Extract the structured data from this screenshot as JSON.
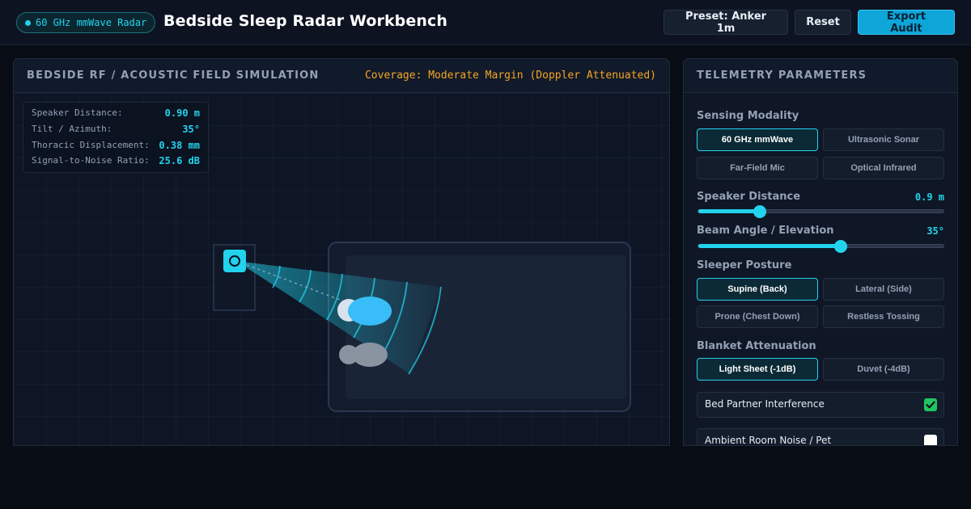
{
  "header": {
    "badge": "60 GHz mmWave Radar",
    "title": "Bedside Sleep Radar Workbench",
    "preset_label": "Preset: Anker 1m",
    "reset_label": "Reset",
    "export_label": "Export Audit"
  },
  "simulation": {
    "title": "BEDSIDE RF / ACOUSTIC FIELD SIMULATION",
    "coverage": "Coverage: Moderate Margin (Doppler Attenuated)",
    "coverage_color": "#f5a524",
    "readouts": [
      {
        "label": "Speaker Distance:",
        "value": "0.90 m"
      },
      {
        "label": "Tilt / Azimuth:",
        "value": "35°"
      },
      {
        "label": "Thoracic Displacement:",
        "value": "0.38 mm"
      },
      {
        "label": "Signal-to-Noise Ratio:",
        "value": "25.6 dB"
      }
    ]
  },
  "telemetry": {
    "title": "TELEMETRY PARAMETERS",
    "modality": {
      "label": "Sensing Modality",
      "options": [
        "60 GHz mmWave",
        "Ultrasonic Sonar",
        "Far-Field Mic",
        "Optical Infrared"
      ],
      "selected": "60 GHz mmWave"
    },
    "distance": {
      "label": "Speaker Distance",
      "value": "0.9 m",
      "fraction": 0.25
    },
    "beam": {
      "label": "Beam Angle / Elevation",
      "value": "35°",
      "fraction": 0.58
    },
    "posture": {
      "label": "Sleeper Posture",
      "options": [
        "Supine (Back)",
        "Lateral (Side)",
        "Prone (Chest Down)",
        "Restless Tossing"
      ],
      "selected": "Supine (Back)"
    },
    "blanket": {
      "label": "Blanket Attenuation",
      "options": [
        "Light Sheet (-1dB)",
        "Duvet (-4dB)"
      ],
      "selected": "Light Sheet (-1dB)"
    },
    "toggles": [
      {
        "label": "Bed Partner Interference",
        "checked": true
      },
      {
        "label": "Ambient Room Noise / Pet",
        "checked": false
      }
    ]
  },
  "colors": {
    "accent": "#22d3ee",
    "warning": "#f5a524",
    "check": "#22c55e"
  }
}
